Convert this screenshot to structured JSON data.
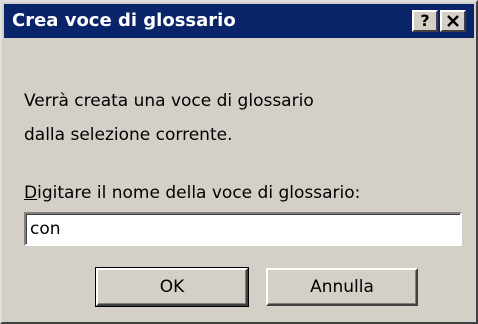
{
  "dialog": {
    "title": "Crea voce di glossario",
    "help_label": "?",
    "message_line1": "Verrà creata una voce di glossario",
    "message_line2": "dalla selezione corrente.",
    "field_label_key": "D",
    "field_label_rest": "igitare il nome della voce di glossario:",
    "name_value": "con",
    "ok_label": "OK",
    "cancel_label": "Annulla"
  },
  "icons": {
    "help": "question-mark-icon",
    "close": "close-icon"
  },
  "colors": {
    "titlebar": "#0a246a",
    "face": "#d4d0c8",
    "title_text": "#ffffff"
  }
}
